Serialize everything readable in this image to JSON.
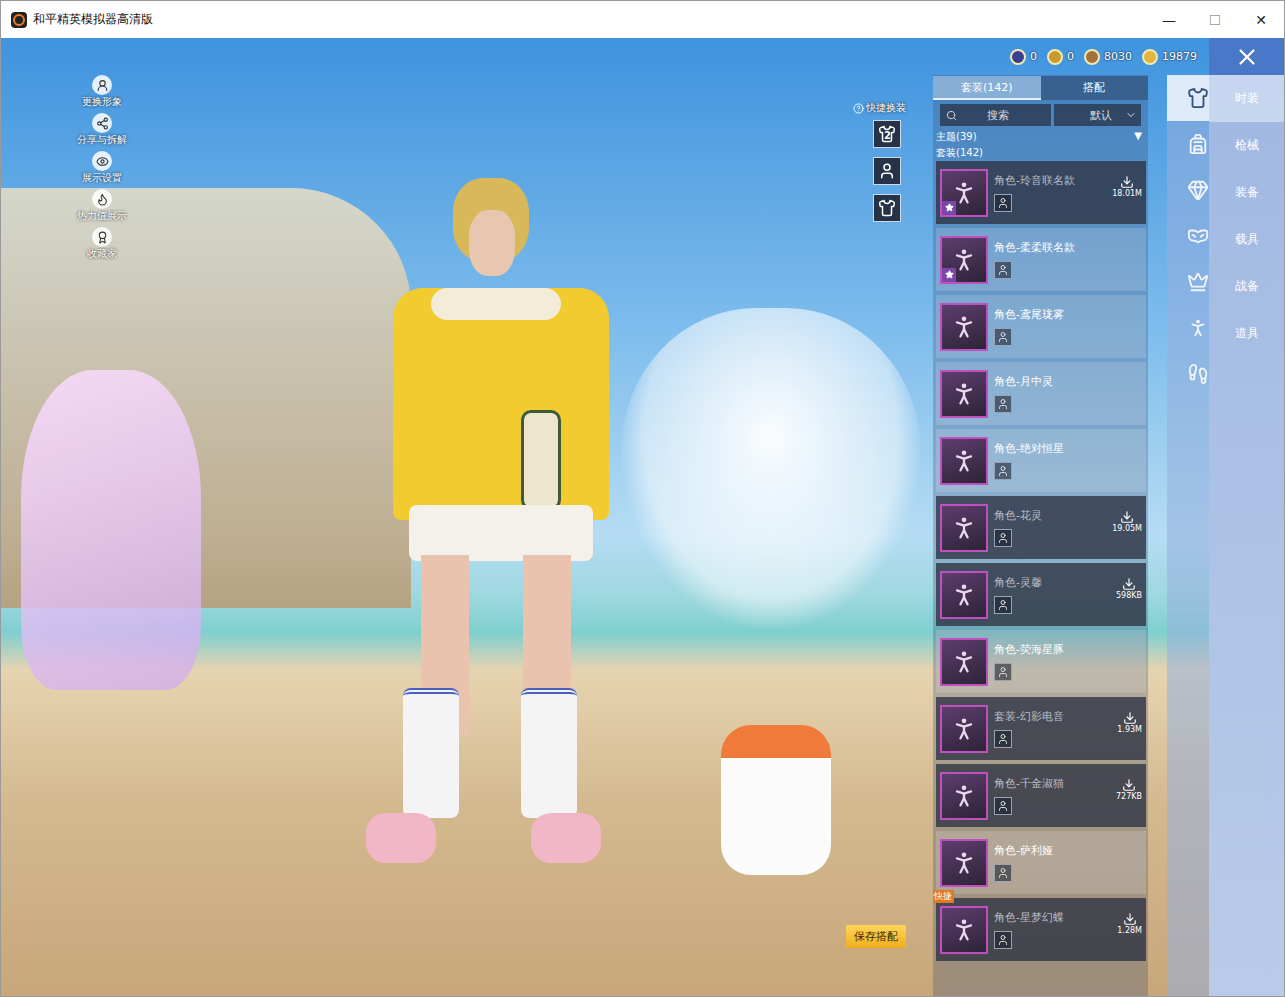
{
  "window": {
    "title": "和平精英模拟器高清版",
    "controls": [
      "—",
      "☐",
      "✕"
    ]
  },
  "scene_menu": [
    {
      "label": "更换形象"
    },
    {
      "label": "分享与拆解"
    },
    {
      "label": "展示设置"
    },
    {
      "label": "热力值展示"
    },
    {
      "label": "收藏家"
    }
  ],
  "currencies": [
    {
      "value": "0",
      "color": "#3b3f8f"
    },
    {
      "value": "0",
      "color": "#c99a2e"
    },
    {
      "value": "8030",
      "color": "#a4713a"
    },
    {
      "value": "19879",
      "color": "#e0b640"
    }
  ],
  "quick_change": {
    "label": "快捷换装",
    "slots": [
      {
        "badge": "2"
      },
      {
        "badge": ""
      },
      {
        "badge": ""
      }
    ]
  },
  "save_button": "保存搭配",
  "panel": {
    "tabs": [
      {
        "label": "套装(142)",
        "selected": true
      },
      {
        "label": "搭配",
        "selected": false
      }
    ],
    "search": {
      "placeholder": "搜索"
    },
    "sort": {
      "value": "默认"
    },
    "filter": {
      "label": "主题(39)",
      "toggle": "▼"
    },
    "section": "套装(142)",
    "items": [
      {
        "name": "角色-玲音联名款",
        "downloaded": false,
        "size": "18.01M",
        "starred": true,
        "tag": ""
      },
      {
        "name": "角色-柔柔联名款",
        "downloaded": true,
        "size": "",
        "starred": true,
        "tag": ""
      },
      {
        "name": "角色-鸢尾珑雾",
        "downloaded": true,
        "size": "",
        "starred": false,
        "tag": ""
      },
      {
        "name": "角色-月中灵",
        "downloaded": true,
        "size": "",
        "starred": false,
        "tag": ""
      },
      {
        "name": "角色-绝对恒星",
        "downloaded": true,
        "size": "",
        "starred": false,
        "tag": ""
      },
      {
        "name": "角色-花灵",
        "downloaded": false,
        "size": "19.05M",
        "starred": false,
        "tag": ""
      },
      {
        "name": "角色-灵馨",
        "downloaded": false,
        "size": "598KB",
        "starred": false,
        "tag": ""
      },
      {
        "name": "角色-荧海星豚",
        "downloaded": true,
        "size": "",
        "starred": false,
        "tag": ""
      },
      {
        "name": "套装-幻影电音",
        "downloaded": false,
        "size": "1.93M",
        "starred": false,
        "tag": ""
      },
      {
        "name": "角色-千金淑猫",
        "downloaded": false,
        "size": "727KB",
        "starred": false,
        "tag": ""
      },
      {
        "name": "角色-萨利娅",
        "downloaded": true,
        "size": "",
        "starred": false,
        "tag": ""
      },
      {
        "name": "角色-星梦幻蝶",
        "downloaded": false,
        "size": "1.28M",
        "starred": false,
        "tag": "快捷"
      }
    ]
  },
  "categories": [
    {
      "selected": true
    },
    {
      "selected": false
    },
    {
      "selected": false
    },
    {
      "selected": false
    },
    {
      "selected": false
    },
    {
      "selected": false
    },
    {
      "selected": false
    }
  ],
  "main_tabs": [
    {
      "label": "时装",
      "selected": true
    },
    {
      "label": "枪械",
      "selected": false
    },
    {
      "label": "装备",
      "selected": false
    },
    {
      "label": "载具",
      "selected": false
    },
    {
      "label": "战备",
      "selected": false
    },
    {
      "label": "道具",
      "selected": false
    }
  ]
}
